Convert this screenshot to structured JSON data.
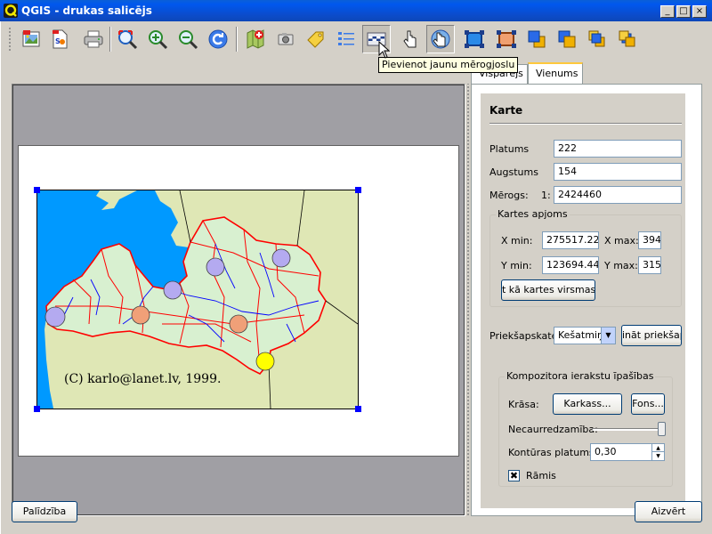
{
  "window": {
    "title": "QGIS - drukas salicējs"
  },
  "titlebar_buttons": {
    "minimize": "_",
    "maximize": "□",
    "close": "×"
  },
  "toolbar": {
    "buttons": [
      {
        "name": "export-image-icon"
      },
      {
        "name": "export-svg-icon"
      },
      {
        "name": "print-icon"
      },
      {
        "name": "zoom-full-icon"
      },
      {
        "name": "zoom-in-icon"
      },
      {
        "name": "zoom-out-icon"
      },
      {
        "name": "refresh-icon"
      },
      {
        "name": "add-map-icon"
      },
      {
        "name": "add-image-icon"
      },
      {
        "name": "add-label-icon"
      },
      {
        "name": "add-legend-icon"
      },
      {
        "name": "add-scalebar-icon"
      },
      {
        "name": "select-move-icon"
      },
      {
        "name": "move-content-icon"
      },
      {
        "name": "group-icon"
      },
      {
        "name": "ungroup-icon"
      },
      {
        "name": "raise-icon"
      },
      {
        "name": "lower-icon"
      },
      {
        "name": "move-top-icon"
      },
      {
        "name": "move-bottom-icon"
      }
    ],
    "tooltip": "Pievienot jaunu mērogjoslu"
  },
  "canvas": {
    "copyright": "(C) karlo@lanet.lv, 1999."
  },
  "tabs": [
    {
      "label": "Vispārējs",
      "selected": false
    },
    {
      "label": "Vienums",
      "selected": true
    }
  ],
  "item_panel": {
    "section_title": "Karte",
    "width_label": "Platums",
    "width_value": "222",
    "height_label": "Augstums",
    "height_value": "154",
    "scale_label": "Mērogs:",
    "scale_prefix": "1:",
    "scale_value": "2424460",
    "extent": {
      "title": "Kartes apjoms",
      "xmin_label": "X min:",
      "xmin_value": "275517.225",
      "xmax_label": "X max:",
      "xmax_value": "394",
      "ymin_label": "Y min:",
      "ymin_value": "123694.441",
      "ymax_label": "Y max:",
      "ymax_value": "315",
      "set_button": "t kā kartes virsmas a"
    },
    "preview_label": "Priekšapskate",
    "preview_select": "Kešatmiņ",
    "preview_button": "ināt priekšap",
    "composer": {
      "title": "Kompozitora ierakstu īpašības",
      "color_label": "Krāsa:",
      "frame_button": "Karkass...",
      "bg_button": "Fons...",
      "opacity_label": "Necaurredzamība:",
      "opacity_value": 0.95,
      "outline_label": "Kontūras platums",
      "outline_value": "0,30",
      "frame_checkbox_label": "Rāmis",
      "frame_checked": true
    }
  },
  "footer": {
    "help_button": "Palīdzība",
    "close_button": "Aizvērt"
  },
  "colors": {
    "titlebar": "#0b4ccb",
    "sea": "#0099ff",
    "land": "#dfe7b5",
    "borders": "#ff0000",
    "rivers": "#0000ff",
    "city_purple": "#b4aaf0",
    "city_orange": "#f0a078",
    "city_yellow": "#ffff00",
    "handle": "#0000ff"
  }
}
